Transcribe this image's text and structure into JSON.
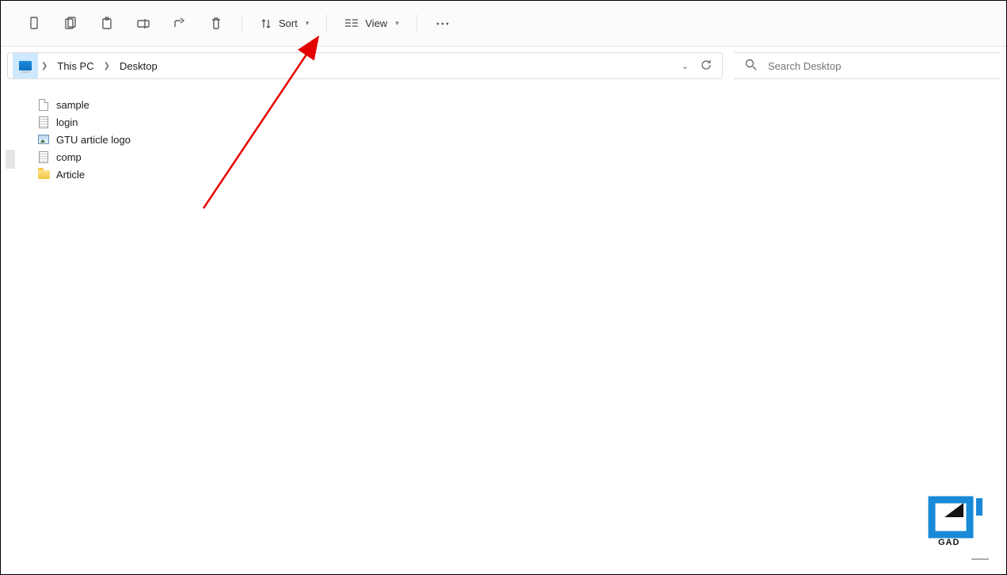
{
  "toolbar": {
    "sort_label": "Sort",
    "view_label": "View"
  },
  "breadcrumb": {
    "root": "This PC",
    "current": "Desktop"
  },
  "search": {
    "placeholder": "Search Desktop"
  },
  "files": [
    {
      "name": "sample",
      "icon": "blank-file"
    },
    {
      "name": "login",
      "icon": "text-file"
    },
    {
      "name": "GTU article logo",
      "icon": "img-file"
    },
    {
      "name": "comp",
      "icon": "text-file"
    },
    {
      "name": "Article",
      "icon": "folder-ic"
    }
  ],
  "watermark": {
    "text": "GAD"
  }
}
